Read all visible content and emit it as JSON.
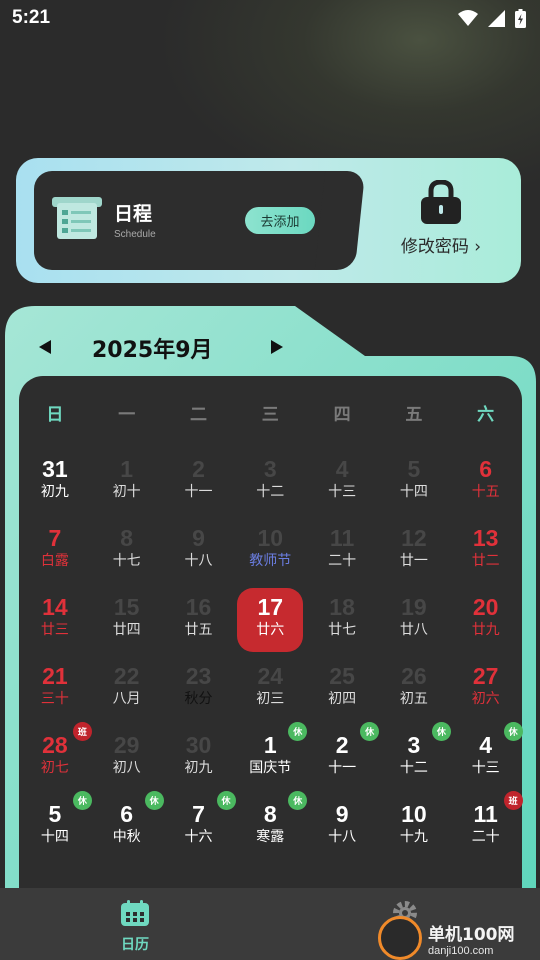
{
  "status_bar": {
    "time": "5:21"
  },
  "schedule_card": {
    "title": "日程",
    "subtitle": "Schedule",
    "add_button": "去添加",
    "password_label": "修改密码 ›"
  },
  "calendar": {
    "month_title": "2025年9月",
    "weekdays": [
      "日",
      "一",
      "二",
      "三",
      "四",
      "五",
      "六"
    ],
    "rows": [
      [
        {
          "day": "31",
          "lunar": "初九"
        },
        {
          "day": "1",
          "lunar": "初十",
          "dim": true
        },
        {
          "day": "2",
          "lunar": "十一",
          "dim": true
        },
        {
          "day": "3",
          "lunar": "十二",
          "dim": true
        },
        {
          "day": "4",
          "lunar": "十三",
          "dim": true
        },
        {
          "day": "5",
          "lunar": "十四",
          "dim": true
        },
        {
          "day": "6",
          "lunar": "十五",
          "red": true
        }
      ],
      [
        {
          "day": "7",
          "lunar": "白露",
          "red": true,
          "term": true
        },
        {
          "day": "8",
          "lunar": "十七",
          "dim": true
        },
        {
          "day": "9",
          "lunar": "十八",
          "dim": true
        },
        {
          "day": "10",
          "lunar": "教师节",
          "dim": true,
          "festival": true
        },
        {
          "day": "11",
          "lunar": "二十",
          "dim": true
        },
        {
          "day": "12",
          "lunar": "廿一",
          "dim": true
        },
        {
          "day": "13",
          "lunar": "廿二",
          "red": true
        }
      ],
      [
        {
          "day": "14",
          "lunar": "廿三",
          "red": true
        },
        {
          "day": "15",
          "lunar": "廿四",
          "dim": true
        },
        {
          "day": "16",
          "lunar": "廿五",
          "dim": true
        },
        {
          "day": "17",
          "lunar": "廿六",
          "today": true
        },
        {
          "day": "18",
          "lunar": "廿七",
          "dim": true
        },
        {
          "day": "19",
          "lunar": "廿八",
          "dim": true
        },
        {
          "day": "20",
          "lunar": "廿九",
          "red": true
        }
      ],
      [
        {
          "day": "21",
          "lunar": "三十",
          "red": true
        },
        {
          "day": "22",
          "lunar": "八月",
          "dim": true
        },
        {
          "day": "23",
          "lunar": "秋分",
          "dim": true,
          "term": true
        },
        {
          "day": "24",
          "lunar": "初三",
          "dim": true
        },
        {
          "day": "25",
          "lunar": "初四",
          "dim": true
        },
        {
          "day": "26",
          "lunar": "初五",
          "dim": true
        },
        {
          "day": "27",
          "lunar": "初六",
          "red": true
        }
      ],
      [
        {
          "day": "28",
          "lunar": "初七",
          "red": true,
          "badge": "班"
        },
        {
          "day": "29",
          "lunar": "初八",
          "dim": true
        },
        {
          "day": "30",
          "lunar": "初九",
          "dim": true
        },
        {
          "day": "1",
          "lunar": "国庆节",
          "badge": "休"
        },
        {
          "day": "2",
          "lunar": "十一",
          "badge": "休"
        },
        {
          "day": "3",
          "lunar": "十二",
          "badge": "休"
        },
        {
          "day": "4",
          "lunar": "十三",
          "badge": "休"
        }
      ],
      [
        {
          "day": "5",
          "lunar": "十四",
          "badge": "休"
        },
        {
          "day": "6",
          "lunar": "中秋",
          "badge": "休"
        },
        {
          "day": "7",
          "lunar": "十六",
          "badge": "休"
        },
        {
          "day": "8",
          "lunar": "寒露",
          "badge": "休"
        },
        {
          "day": "9",
          "lunar": "十八"
        },
        {
          "day": "10",
          "lunar": "十九"
        },
        {
          "day": "11",
          "lunar": "二十",
          "badge": "班"
        }
      ]
    ]
  },
  "bottom_nav": {
    "calendar_label": "日历"
  },
  "watermark": {
    "title": "单机100网",
    "url": "danji100.com"
  },
  "colors": {
    "accent": "#6fd9c0",
    "holiday_red": "#e0313a",
    "today_bg": "#c62a2f",
    "rest_badge": "#4bb960",
    "work_badge": "#c0242c"
  }
}
